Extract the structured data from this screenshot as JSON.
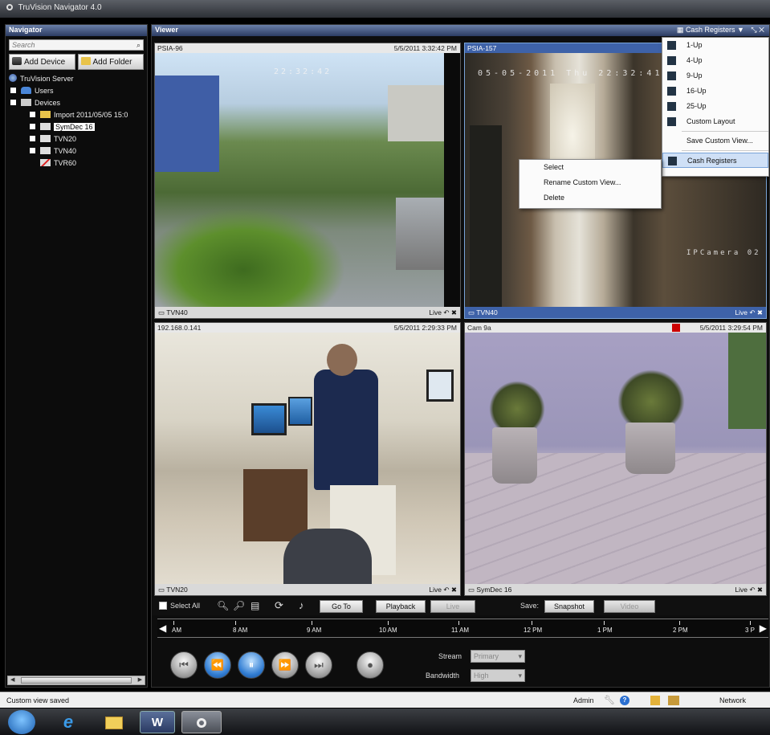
{
  "window": {
    "title": "TruVision Navigator 4.0"
  },
  "navigator": {
    "header": "Navigator",
    "search_placeholder": "Search",
    "add_device": "Add Device",
    "add_folder": "Add Folder",
    "tree": [
      {
        "label": "TruVision Server"
      },
      {
        "label": "Users"
      },
      {
        "label": "Devices"
      },
      {
        "label": "Import 2011/05/05 15:0"
      },
      {
        "label": "SymDec 16"
      },
      {
        "label": "TVN20"
      },
      {
        "label": "TVN40"
      },
      {
        "label": "TVR60"
      }
    ]
  },
  "viewer": {
    "header": "Viewer",
    "layout_selector": "Cash Registers",
    "panes": [
      {
        "camera": "PSIA-96",
        "timestamp": "5/5/2011 3:32:42 PM",
        "device": "TVN40",
        "mode": "Live",
        "osd": "22:32:42"
      },
      {
        "camera": "PSIA-157",
        "timestamp": "",
        "device": "TVN40",
        "mode": "Live",
        "osd": "05-05-2011 Thu 22:32:41",
        "osd2": "IPCamera 02"
      },
      {
        "camera": "192.168.0.141",
        "timestamp": "5/5/2011 2:29:33 PM",
        "device": "TVN20",
        "mode": "Live"
      },
      {
        "camera": "Cam 9a",
        "timestamp": "5/5/2011 3:29:54 PM",
        "device": "SymDec 16",
        "mode": "Live"
      }
    ]
  },
  "layout_menu": {
    "items": [
      "1-Up",
      "4-Up",
      "9-Up",
      "16-Up",
      "25-Up",
      "Custom Layout",
      "Save Custom View...",
      "Cash Registers"
    ]
  },
  "custom_view_menu": {
    "items": [
      "Select",
      "Rename Custom View...",
      "Delete"
    ]
  },
  "toolbar": {
    "select_all": "Select All",
    "go_to": "Go To",
    "playback": "Playback",
    "live": "Live",
    "save_label": "Save:",
    "snapshot": "Snapshot",
    "video": "Video"
  },
  "timeline": {
    "labels": [
      "AM",
      "8 AM",
      "9 AM",
      "10 AM",
      "11 AM",
      "12 PM",
      "1 PM",
      "2 PM",
      "3 P"
    ]
  },
  "playback_controls": {
    "stream_label": "Stream",
    "stream_value": "Primary",
    "bandwidth_label": "Bandwidth",
    "bandwidth_value": "High"
  },
  "status": {
    "message": "Custom view saved",
    "user": "Admin",
    "network": "Network"
  },
  "taskbar": {
    "word": "W"
  }
}
